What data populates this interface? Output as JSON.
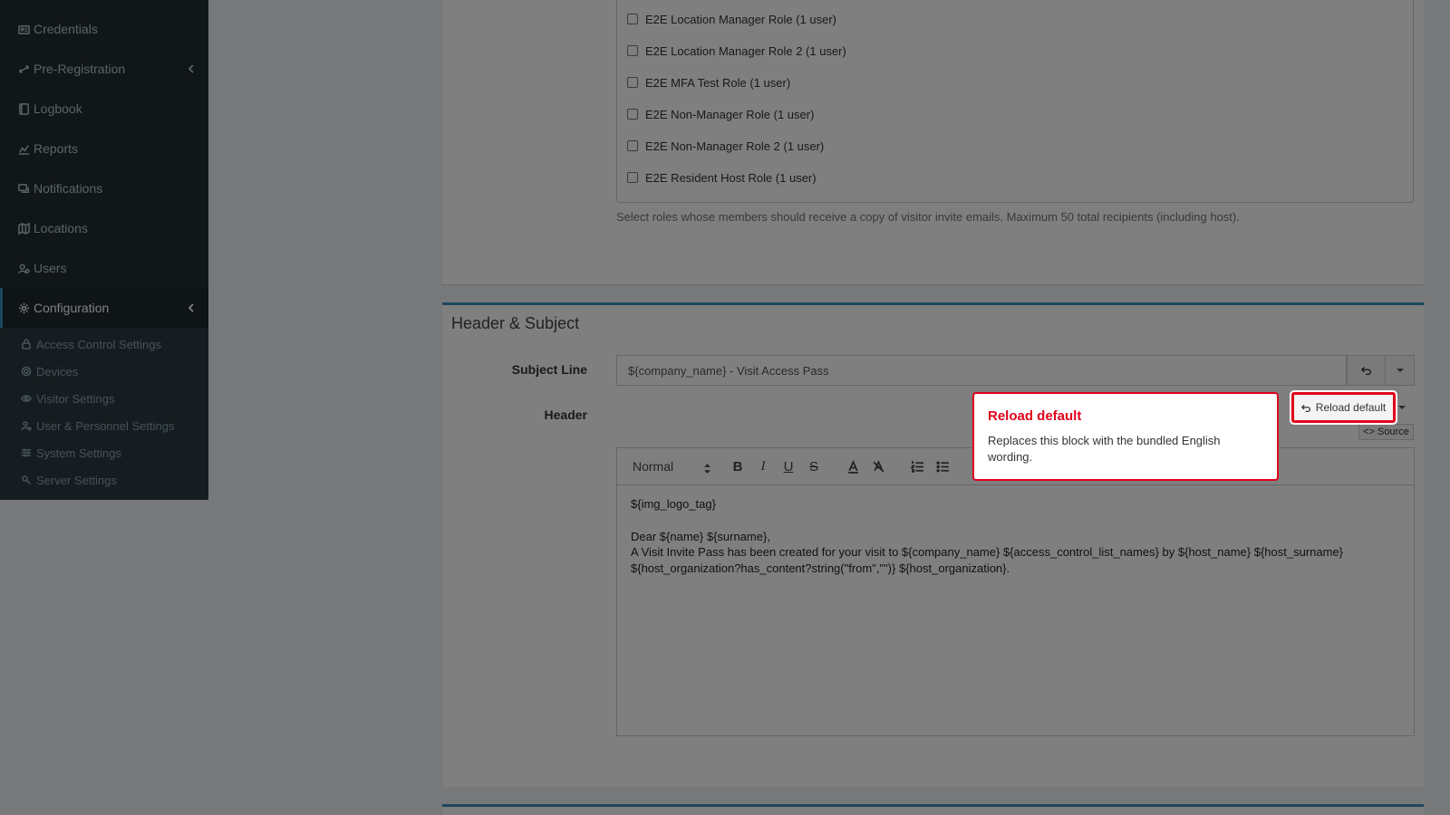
{
  "sidebar": {
    "items": [
      {
        "label": "Credentials",
        "icon": "id-card-icon"
      },
      {
        "label": "Pre-Registration",
        "icon": "exchange-icon"
      },
      {
        "label": "Logbook",
        "icon": "book-icon"
      },
      {
        "label": "Reports",
        "icon": "chart-icon"
      },
      {
        "label": "Notifications",
        "icon": "chat-icon"
      },
      {
        "label": "Locations",
        "icon": "map-icon"
      },
      {
        "label": "Users",
        "icon": "users-icon"
      },
      {
        "label": "Configuration",
        "icon": "gear-icon"
      }
    ],
    "submenu": [
      {
        "label": "Access Control Settings",
        "icon": "lock-icon"
      },
      {
        "label": "Devices",
        "icon": "devices-icon"
      },
      {
        "label": "Visitor Settings",
        "icon": "eye-icon"
      },
      {
        "label": "User & Personnel Settings",
        "icon": "user-cog-icon"
      },
      {
        "label": "System Settings",
        "icon": "sliders-icon"
      },
      {
        "label": "Server Settings",
        "icon": "server-cog-icon"
      }
    ]
  },
  "roles": [
    "E2E Location Manager Role (1 user)",
    "E2E Location Manager Role 2 (1 user)",
    "E2E MFA Test Role (1 user)",
    "E2E Non-Manager Role (1 user)",
    "E2E Non-Manager Role 2 (1 user)",
    "E2E Resident Host Role (1 user)"
  ],
  "roles_help": "Select roles whose members should receive a copy of visitor invite emails. Maximum 50 total recipients (including host).",
  "header_section": {
    "title": "Header & Subject",
    "subject_label": "Subject Line",
    "subject_value": "${company_name} - Visit Access Pass",
    "header_label": "Header",
    "reload_label": "Reload default",
    "source_label": "<> Source",
    "format_select": "Normal",
    "editor_lines": [
      "${img_logo_tag}",
      "",
      "Dear ${name} ${surname},",
      "A Visit Invite Pass has been created for your visit to ${company_name} ${access_control_list_names} by ${host_name} ${host_surname}",
      "${host_organization?has_content?string(\"from\",\"\")} ${host_organization}."
    ]
  },
  "tooltip": {
    "title": "Reload default",
    "text": "Replaces this block with the bundled English wording."
  },
  "colors": {
    "highlight": "#e0001b",
    "accent": "#3c8dbc",
    "sidebar_bg": "#222d32"
  }
}
